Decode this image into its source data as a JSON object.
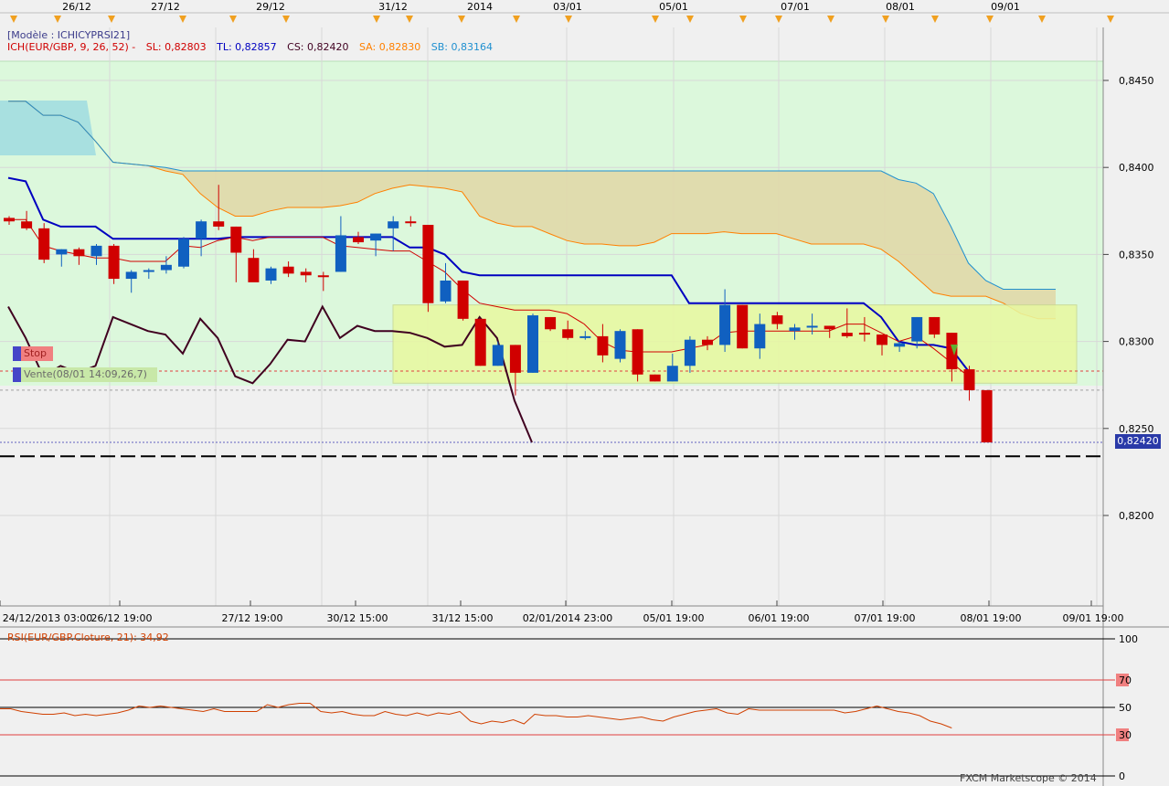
{
  "header": {
    "dates": [
      "26/12",
      "27/12",
      "29/12",
      "31/12",
      "2014",
      "03/01",
      "05/01",
      "07/01",
      "08/01",
      "09/01"
    ]
  },
  "legend": {
    "model": "[Modèle : ICHICYPRSI21]",
    "ich_name": "ICH(EUR/GBP, 9, 26, 52) -",
    "sl": "SL: 0,82803",
    "tl": "TL: 0,82857",
    "cs": "CS: 0,82420",
    "sa": "SA: 0,82830",
    "sb": "SB: 0,83164",
    "colors": {
      "sl": "#d00000",
      "tl": "#0000c0",
      "cs": "#400020",
      "sa": "#ff8000",
      "sb": "#2090d0"
    }
  },
  "tags": {
    "stop": "Stop",
    "vente": "Vente(08/01 14:09,26,7)"
  },
  "price_badge": "0,82420",
  "rsi_title": "RSI(EUR/GBP.Cloture, 21): 34,92",
  "copyright": "FXCM Marketscope © 2014",
  "chart_data": [
    {
      "type": "candlestick",
      "title": "",
      "y_ticks": [
        "0,8450",
        "0,8400",
        "0,8350",
        "0,8300",
        "0,8250",
        "0,8200"
      ],
      "ylim": [
        0.8155,
        0.8473
      ],
      "x_ticks": [
        "24/12/2013 03:00",
        "26/12 19:00",
        "27/12 19:00",
        "30/12 15:00",
        "31/12 15:00",
        "02/01/2014 23:00",
        "05/01 19:00",
        "06/01 19:00",
        "07/01 19:00",
        "08/01 19:00",
        "09/01 19:00"
      ],
      "candles": [
        [
          0.8371,
          0.8372,
          0.8367,
          0.8369
        ],
        [
          0.8369,
          0.8375,
          0.8364,
          0.8365
        ],
        [
          0.8365,
          0.8368,
          0.8345,
          0.8347
        ],
        [
          0.835,
          0.8353,
          0.8343,
          0.8353
        ],
        [
          0.8353,
          0.8354,
          0.8344,
          0.8349
        ],
        [
          0.8349,
          0.8356,
          0.8344,
          0.8355
        ],
        [
          0.8355,
          0.8356,
          0.8333,
          0.8336
        ],
        [
          0.8336,
          0.8341,
          0.8328,
          0.834
        ],
        [
          0.834,
          0.8342,
          0.8336,
          0.8341
        ],
        [
          0.8341,
          0.8349,
          0.8339,
          0.8344
        ],
        [
          0.8343,
          0.836,
          0.8342,
          0.8359
        ],
        [
          0.8359,
          0.837,
          0.8349,
          0.8369
        ],
        [
          0.8369,
          0.839,
          0.8364,
          0.8366
        ],
        [
          0.8366,
          0.8366,
          0.8334,
          0.8351
        ],
        [
          0.8348,
          0.8353,
          0.8342,
          0.8334
        ],
        [
          0.8335,
          0.8343,
          0.8333,
          0.8342
        ],
        [
          0.8343,
          0.8346,
          0.8337,
          0.8339
        ],
        [
          0.834,
          0.8342,
          0.8334,
          0.8338
        ],
        [
          0.8338,
          0.834,
          0.8329,
          0.8337
        ],
        [
          0.834,
          0.8372,
          0.834,
          0.8361
        ],
        [
          0.836,
          0.8363,
          0.8356,
          0.8357
        ],
        [
          0.8358,
          0.8362,
          0.8349,
          0.8362
        ],
        [
          0.8365,
          0.8372,
          0.8352,
          0.8369
        ],
        [
          0.8369,
          0.8372,
          0.8366,
          0.8368
        ],
        [
          0.8367,
          0.8367,
          0.8317,
          0.8322
        ],
        [
          0.8323,
          0.8345,
          0.8322,
          0.8335
        ],
        [
          0.8335,
          0.8335,
          0.8312,
          0.8313
        ],
        [
          0.8313,
          0.8313,
          0.8286,
          0.8286
        ],
        [
          0.8286,
          0.83,
          0.8286,
          0.8298
        ],
        [
          0.8298,
          0.8298,
          0.8269,
          0.8282
        ],
        [
          0.8282,
          0.8316,
          0.8282,
          0.8315
        ],
        [
          0.8314,
          0.8314,
          0.8306,
          0.8307
        ],
        [
          0.8307,
          0.8312,
          0.8301,
          0.8302
        ],
        [
          0.8302,
          0.8306,
          0.8301,
          0.8303
        ],
        [
          0.8303,
          0.831,
          0.8288,
          0.8292
        ],
        [
          0.829,
          0.8307,
          0.8288,
          0.8306
        ],
        [
          0.8307,
          0.8307,
          0.8277,
          0.8281
        ],
        [
          0.8281,
          0.8281,
          0.8277,
          0.8277
        ],
        [
          0.8277,
          0.8293,
          0.8277,
          0.8286
        ],
        [
          0.8286,
          0.8303,
          0.8282,
          0.8301
        ],
        [
          0.8301,
          0.8303,
          0.8295,
          0.8298
        ],
        [
          0.8298,
          0.833,
          0.8294,
          0.8321
        ],
        [
          0.8321,
          0.8321,
          0.8296,
          0.8296
        ],
        [
          0.8296,
          0.8316,
          0.829,
          0.831
        ],
        [
          0.8315,
          0.8317,
          0.8307,
          0.831
        ],
        [
          0.8306,
          0.831,
          0.8301,
          0.8308
        ],
        [
          0.8308,
          0.8316,
          0.8304,
          0.8309
        ],
        [
          0.8309,
          0.8309,
          0.8302,
          0.8307
        ],
        [
          0.8305,
          0.8319,
          0.8302,
          0.8303
        ],
        [
          0.8305,
          0.8314,
          0.83,
          0.8304
        ],
        [
          0.8304,
          0.8304,
          0.8292,
          0.8298
        ],
        [
          0.8297,
          0.83,
          0.8294,
          0.8299
        ],
        [
          0.83,
          0.8314,
          0.8296,
          0.8314
        ],
        [
          0.8314,
          0.8314,
          0.8302,
          0.8304
        ],
        [
          0.8305,
          0.8305,
          0.8277,
          0.8284
        ],
        [
          0.8284,
          0.8286,
          0.8266,
          0.8272
        ],
        [
          0.8272,
          0.8272,
          0.8242,
          0.8242
        ]
      ],
      "tenkan": [
        0.837,
        0.837,
        0.8355,
        0.8352,
        0.835,
        0.8348,
        0.8348,
        0.8346,
        0.8346,
        0.8346,
        0.8355,
        0.8354,
        0.8358,
        0.836,
        0.8358,
        0.836,
        0.836,
        0.836,
        0.836,
        0.8355,
        0.8354,
        0.8353,
        0.8352,
        0.8352,
        0.8346,
        0.834,
        0.833,
        0.8322,
        0.832,
        0.8318,
        0.8318,
        0.8318,
        0.8316,
        0.831,
        0.83,
        0.8295,
        0.8294,
        0.8294,
        0.8294,
        0.8296,
        0.8298,
        0.8305,
        0.8306,
        0.8306,
        0.8306,
        0.8306,
        0.8306,
        0.8306,
        0.831,
        0.831,
        0.8305,
        0.83,
        0.8303,
        0.8296,
        0.8288,
        0.828
      ],
      "kijun": [
        0.8394,
        0.8392,
        0.837,
        0.8366,
        0.8366,
        0.8366,
        0.8359,
        0.8359,
        0.8359,
        0.8359,
        0.8359,
        0.8359,
        0.8359,
        0.836,
        0.836,
        0.836,
        0.836,
        0.836,
        0.836,
        0.836,
        0.836,
        0.836,
        0.836,
        0.8354,
        0.8354,
        0.835,
        0.834,
        0.8338,
        0.8338,
        0.8338,
        0.8338,
        0.8338,
        0.8338,
        0.8338,
        0.8338,
        0.8338,
        0.8338,
        0.8338,
        0.8338,
        0.8322,
        0.8322,
        0.8322,
        0.8322,
        0.8322,
        0.8322,
        0.8322,
        0.8322,
        0.8322,
        0.8322,
        0.8322,
        0.8314,
        0.83,
        0.8298,
        0.8298,
        0.8296,
        0.8283
      ],
      "senkou_a": [
        0.8438,
        0.8438,
        0.843,
        0.843,
        0.8426,
        0.8415,
        0.8403,
        0.8402,
        0.8401,
        0.8398,
        0.8396,
        0.8385,
        0.8377,
        0.8372,
        0.8372,
        0.8375,
        0.8377,
        0.8377,
        0.8377,
        0.8378,
        0.838,
        0.8385,
        0.8388,
        0.839,
        0.8389,
        0.8388,
        0.8386,
        0.8372,
        0.8368,
        0.8366,
        0.8366,
        0.8362,
        0.8358,
        0.8356,
        0.8356,
        0.8355,
        0.8355,
        0.8357,
        0.8362,
        0.8362,
        0.8362,
        0.8363,
        0.8362,
        0.8362,
        0.8362,
        0.8359,
        0.8356,
        0.8356,
        0.8356,
        0.8356,
        0.8353,
        0.8346,
        0.8337,
        0.8328,
        0.8326,
        0.8326,
        0.8326,
        0.8322,
        0.8316,
        0.8313,
        0.8313
      ],
      "senkou_b": [
        0.8438,
        0.8438,
        0.843,
        0.843,
        0.8426,
        0.8415,
        0.8403,
        0.8402,
        0.8401,
        0.84,
        0.8398,
        0.8398,
        0.8398,
        0.8398,
        0.8398,
        0.8398,
        0.8398,
        0.8398,
        0.8398,
        0.8398,
        0.8398,
        0.8398,
        0.8398,
        0.8398,
        0.8398,
        0.8398,
        0.8398,
        0.8398,
        0.8398,
        0.8398,
        0.8398,
        0.8398,
        0.8398,
        0.8398,
        0.8398,
        0.8398,
        0.8398,
        0.8398,
        0.8398,
        0.8398,
        0.8398,
        0.8398,
        0.8398,
        0.8398,
        0.8398,
        0.8398,
        0.8398,
        0.8398,
        0.8398,
        0.8398,
        0.8398,
        0.8393,
        0.8391,
        0.8385,
        0.8366,
        0.8345,
        0.8335,
        0.833,
        0.833,
        0.833,
        0.833
      ],
      "chikou": [
        0.832,
        0.8302,
        0.828,
        0.8286,
        0.8282,
        0.8286,
        0.8314,
        0.831,
        0.8306,
        0.8304,
        0.8293,
        0.8313,
        0.8302,
        0.828,
        0.8276,
        0.8287,
        0.8301,
        0.83,
        0.832,
        0.8302,
        0.8309,
        0.8306,
        0.8306,
        0.8305,
        0.8302,
        0.8297,
        0.8298,
        0.8314,
        0.8302,
        0.8266,
        0.8242
      ],
      "levels": {
        "sell_entry": 0.8283,
        "stop": 0.8272,
        "current": 0.8242,
        "target": 0.8234
      },
      "box": {
        "from_candle": 22,
        "to_candle": 60,
        "high": 0.8321,
        "low": 0.8276
      }
    },
    {
      "type": "line",
      "title": "RSI(EUR/GBP.Cloture, 21): 34,92",
      "ylim": [
        0,
        100
      ],
      "y_ticks": [
        "100",
        "70",
        "50",
        "30",
        "0"
      ],
      "levels": [
        70,
        50,
        30
      ],
      "values": [
        49,
        49,
        47,
        46,
        45,
        45,
        46,
        44,
        45,
        44,
        45,
        46,
        48,
        51,
        50,
        51,
        50,
        49,
        48,
        47,
        49,
        47,
        47,
        47,
        47,
        52,
        50,
        52,
        53,
        53,
        47,
        46,
        47,
        45,
        44,
        44,
        47,
        45,
        44,
        46,
        44,
        46,
        45,
        47,
        40,
        38,
        40,
        39,
        41,
        38,
        45,
        44,
        44,
        43,
        43,
        44,
        43,
        42,
        41,
        42,
        43,
        41,
        40,
        43,
        45,
        47,
        48,
        49,
        46,
        45,
        49,
        48,
        48,
        48,
        48,
        48,
        48,
        48,
        48,
        46,
        47,
        49,
        51,
        49,
        47,
        46,
        44,
        40,
        38,
        35
      ]
    }
  ]
}
